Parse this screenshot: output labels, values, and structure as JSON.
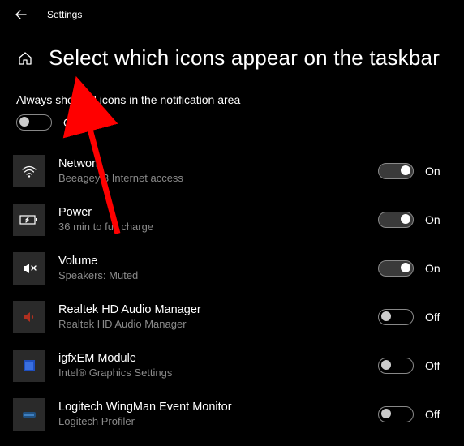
{
  "app": {
    "title": "Settings"
  },
  "page": {
    "title": "Select which icons appear on the taskbar"
  },
  "section": {
    "label": "Always show all icons in the notification area",
    "master": {
      "on": false,
      "label": "Off"
    }
  },
  "toggle_labels": {
    "on": "On",
    "off": "Off"
  },
  "items": [
    {
      "id": "network",
      "title": "Network",
      "sub": "Beeagey 3 Internet access",
      "on": true,
      "icon": "wifi"
    },
    {
      "id": "power",
      "title": "Power",
      "sub": "36 min to full charge",
      "on": true,
      "icon": "battery"
    },
    {
      "id": "volume",
      "title": "Volume",
      "sub": "Speakers: Muted",
      "on": true,
      "icon": "volume-muted"
    },
    {
      "id": "realtek",
      "title": "Realtek HD Audio Manager",
      "sub": "Realtek HD Audio Manager",
      "on": false,
      "icon": "speaker"
    },
    {
      "id": "igfx",
      "title": "igfxEM Module",
      "sub": "Intel® Graphics Settings",
      "on": false,
      "icon": "intel"
    },
    {
      "id": "logitech",
      "title": "Logitech WingMan Event Monitor",
      "sub": "Logitech Profiler",
      "on": false,
      "icon": "logitech"
    }
  ]
}
